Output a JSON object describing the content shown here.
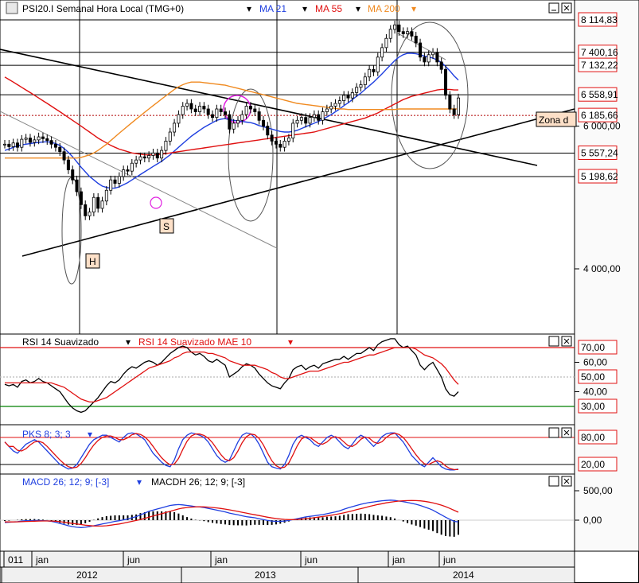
{
  "colors": {
    "price": "#000000",
    "ma21": "#1f3fe0",
    "ma55": "#e01010",
    "ma200": "#f08a20",
    "magenta": "#e020e0",
    "green": "#008000",
    "axis_bg": "#f4f4f4"
  },
  "header": {
    "title": "PSI20.I Semanal Hora Local (TMG+0)",
    "ma21": "MA 21",
    "ma55": "MA 55",
    "ma200": "MA 200"
  },
  "annotations": {
    "h": "H",
    "s": "S",
    "zona": "Zona d"
  },
  "price_labels": [
    {
      "text": "8 114,83",
      "value": 8114.83,
      "color": "#e01010"
    },
    {
      "text": "7 400,16",
      "value": 7400.16,
      "color": "#e01010"
    },
    {
      "text": "7 132,22",
      "value": 7132.22,
      "color": "#e01010"
    },
    {
      "text": "6 558,91",
      "value": 6558.91,
      "color": "#e01010"
    },
    {
      "text": "6 185,66",
      "value": 6185.66,
      "color": "#e01010"
    },
    {
      "text": "5 557,24",
      "value": 5557.24,
      "color": "#e01010"
    },
    {
      "text": "5 198,62",
      "value": 5198.62,
      "color": "#e01010"
    }
  ],
  "price_ticks": [
    {
      "text": "6 000,00",
      "value": 6000
    },
    {
      "text": "4 000,00",
      "value": 4000
    }
  ],
  "rsi": {
    "label": "RSI 14 Suavizado",
    "label2": "RSI 14 Suavizado MAE 10",
    "badges": [
      {
        "text": "70,00",
        "value": 70
      },
      {
        "text": "50,00",
        "value": 50
      },
      {
        "text": "30,00",
        "value": 30
      }
    ],
    "ticks": [
      {
        "text": "60,00",
        "value": 60
      },
      {
        "text": "40,00",
        "value": 40
      }
    ]
  },
  "pks": {
    "label": "PKS 8; 3; 3",
    "badges": [
      {
        "text": "80,00",
        "value": 80
      },
      {
        "text": "20,00",
        "value": 20
      }
    ]
  },
  "macd": {
    "label": "MACD 26; 12; 9; [-3]",
    "label2": "MACDH 26; 12; 9; [-3]",
    "ticks": [
      {
        "text": "500,00",
        "value": 500
      },
      {
        "text": "0,00",
        "value": 0
      }
    ]
  },
  "time_axis": {
    "months": [
      "011",
      "jan",
      "jun",
      "jan",
      "jun",
      "jan",
      "jun"
    ],
    "years": [
      "2012",
      "2013",
      "2014"
    ]
  },
  "chart_data": {
    "type": "line",
    "instrument": "PSI20.I",
    "timeframe": "Semanal",
    "y_range": [
      3300,
      8200
    ],
    "close": [
      5700,
      5660,
      5720,
      5650,
      5780,
      5800,
      5730,
      5770,
      5820,
      5790,
      5760,
      5700,
      5650,
      5580,
      5450,
      5300,
      5150,
      4980,
      4800,
      4650,
      4700,
      4900,
      4750,
      4850,
      5000,
      5150,
      5100,
      5200,
      5300,
      5280,
      5400,
      5450,
      5500,
      5480,
      5520,
      5560,
      5480,
      5600,
      5750,
      5900,
      6050,
      6200,
      6350,
      6400,
      6300,
      6250,
      6350,
      6300,
      6200,
      6150,
      6300,
      6250,
      6200,
      5950,
      6050,
      6100,
      6200,
      6350,
      6300,
      6250,
      6100,
      6000,
      5850,
      5750,
      5700,
      5650,
      5750,
      5800,
      6050,
      6100,
      6150,
      6050,
      6150,
      6200,
      6100,
      6250,
      6300,
      6350,
      6400,
      6450,
      6550,
      6500,
      6600,
      6700,
      6750,
      6900,
      7050,
      7000,
      7300,
      7500,
      7700,
      7900,
      8000,
      7850,
      7800,
      7850,
      7750,
      7600,
      7300,
      7200,
      7350,
      7400,
      7200,
      7050,
      6550,
      6300,
      6200,
      6500
    ],
    "series": [
      {
        "name": "MA 21",
        "values": [
          5600,
          5620,
          5650,
          5670,
          5690,
          5700,
          5710,
          5720,
          5730,
          5735,
          5740,
          5730,
          5710,
          5680,
          5630,
          5570,
          5500,
          5420,
          5340,
          5270,
          5200,
          5150,
          5100,
          5060,
          5040,
          5030,
          5030,
          5050,
          5080,
          5110,
          5150,
          5190,
          5230,
          5270,
          5310,
          5350,
          5390,
          5430,
          5480,
          5530,
          5590,
          5650,
          5710,
          5770,
          5830,
          5880,
          5930,
          5980,
          6020,
          6060,
          6100,
          6120,
          6130,
          6110,
          6100,
          6090,
          6080,
          6070,
          6060,
          6040,
          6010,
          5990,
          5970,
          5950,
          5930,
          5910,
          5900,
          5900,
          5910,
          5930,
          5960,
          5990,
          6020,
          6050,
          6080,
          6120,
          6160,
          6200,
          6250,
          6300,
          6360,
          6410,
          6470,
          6530,
          6590,
          6660,
          6730,
          6800,
          6880,
          6960,
          7050,
          7140,
          7230,
          7300,
          7350,
          7380,
          7380,
          7370,
          7350,
          7320,
          7300,
          7280,
          7240,
          7190,
          7110,
          7020,
          6920,
          6840
        ]
      },
      {
        "name": "MA 55",
        "values": [
          6900,
          6850,
          6800,
          6750,
          6700,
          6650,
          6600,
          6550,
          6500,
          6450,
          6400,
          6350,
          6300,
          6250,
          6200,
          6150,
          6100,
          6050,
          6000,
          5950,
          5900,
          5850,
          5800,
          5760,
          5720,
          5680,
          5650,
          5620,
          5600,
          5580,
          5560,
          5550,
          5540,
          5530,
          5530,
          5530,
          5530,
          5540,
          5550,
          5560,
          5570,
          5580,
          5590,
          5600,
          5610,
          5620,
          5630,
          5640,
          5650,
          5660,
          5670,
          5680,
          5690,
          5700,
          5710,
          5720,
          5730,
          5740,
          5750,
          5760,
          5770,
          5780,
          5790,
          5800,
          5810,
          5820,
          5830,
          5840,
          5850,
          5860,
          5870,
          5880,
          5890,
          5900,
          5920,
          5940,
          5960,
          5980,
          6000,
          6020,
          6040,
          6060,
          6080,
          6100,
          6120,
          6140,
          6170,
          6200,
          6230,
          6270,
          6310,
          6350,
          6390,
          6430,
          6470,
          6500,
          6530,
          6550,
          6570,
          6590,
          6610,
          6630,
          6650,
          6660,
          6660,
          6660,
          6650,
          6650
        ]
      },
      {
        "name": "MA 200",
        "values": [
          5480,
          5480,
          5480,
          5480,
          5480,
          5480,
          5480,
          5480,
          5480,
          5480,
          5480,
          5480,
          5480,
          5480,
          5480,
          5480,
          5480,
          5480,
          5490,
          5510,
          5530,
          5560,
          5600,
          5650,
          5700,
          5760,
          5820,
          5880,
          5940,
          6000,
          6060,
          6120,
          6180,
          6240,
          6300,
          6360,
          6420,
          6480,
          6540,
          6600,
          6660,
          6710,
          6750,
          6780,
          6800,
          6800,
          6800,
          6790,
          6780,
          6770,
          6760,
          6750,
          6740,
          6720,
          6700,
          6680,
          6660,
          6640,
          6620,
          6600,
          6580,
          6560,
          6540,
          6520,
          6500,
          6480,
          6460,
          6440,
          6420,
          6400,
          6390,
          6380,
          6370,
          6360,
          6350,
          6340,
          6330,
          6320,
          6310,
          6300,
          6300,
          6290,
          6290,
          6290,
          6290,
          6290,
          6290,
          6290,
          6290,
          6290,
          6290,
          6290,
          6290,
          6300,
          6300,
          6300,
          6300,
          6300,
          6300,
          6300,
          6300,
          6300,
          6300,
          6300,
          6300,
          6300,
          6300,
          6300
        ]
      }
    ],
    "rsi": [
      45,
      44,
      45,
      43,
      47,
      48,
      46,
      47,
      49,
      47,
      46,
      44,
      42,
      40,
      36,
      32,
      29,
      27,
      26,
      27,
      30,
      33,
      36,
      40,
      44,
      47,
      46,
      48,
      52,
      55,
      57,
      56,
      58,
      60,
      61,
      60,
      58,
      60,
      63,
      66,
      68,
      70,
      71,
      70,
      67,
      65,
      66,
      64,
      61,
      60,
      62,
      60,
      58,
      50,
      52,
      54,
      57,
      59,
      58,
      56,
      52,
      49,
      46,
      44,
      43,
      42,
      46,
      49,
      55,
      57,
      58,
      55,
      57,
      58,
      56,
      59,
      60,
      61,
      62,
      62,
      64,
      62,
      64,
      66,
      66,
      68,
      70,
      68,
      72,
      74,
      75,
      76,
      76,
      72,
      70,
      71,
      68,
      65,
      58,
      55,
      58,
      60,
      55,
      50,
      42,
      38,
      37,
      40
    ],
    "rsi_ma": [
      46,
      46,
      46,
      46,
      46,
      46,
      46,
      46,
      46,
      46,
      46,
      46,
      45,
      44,
      43,
      41,
      39,
      37,
      35,
      34,
      33,
      33,
      34,
      35,
      36,
      38,
      40,
      42,
      44,
      46,
      48,
      50,
      52,
      54,
      56,
      57,
      58,
      59,
      60,
      61,
      63,
      64,
      66,
      67,
      67,
      67,
      67,
      67,
      66,
      66,
      65,
      64,
      63,
      61,
      60,
      59,
      58,
      58,
      58,
      58,
      57,
      56,
      55,
      53,
      52,
      50,
      49,
      49,
      50,
      51,
      52,
      53,
      54,
      54,
      54,
      55,
      56,
      57,
      58,
      59,
      60,
      60,
      61,
      62,
      63,
      64,
      65,
      65,
      66,
      67,
      68,
      69,
      70,
      70,
      70,
      70,
      70,
      69,
      67,
      65,
      64,
      63,
      61,
      59,
      56,
      52,
      48,
      45
    ],
    "pks": [
      70,
      60,
      50,
      45,
      55,
      65,
      70,
      75,
      70,
      60,
      50,
      40,
      30,
      20,
      15,
      10,
      12,
      20,
      35,
      50,
      65,
      75,
      80,
      85,
      85,
      80,
      75,
      70,
      80,
      88,
      90,
      88,
      82,
      75,
      60,
      45,
      35,
      25,
      18,
      15,
      30,
      55,
      75,
      85,
      90,
      88,
      85,
      80,
      70,
      55,
      40,
      30,
      25,
      30,
      50,
      70,
      85,
      90,
      88,
      80,
      65,
      45,
      25,
      15,
      12,
      10,
      20,
      40,
      65,
      80,
      85,
      80,
      75,
      65,
      60,
      70,
      80,
      85,
      80,
      70,
      60,
      55,
      65,
      78,
      85,
      80,
      70,
      60,
      70,
      82,
      88,
      90,
      90,
      80,
      70,
      55,
      40,
      30,
      20,
      15,
      25,
      35,
      25,
      15,
      10,
      8,
      8,
      10
    ],
    "macd": [
      -40,
      -35,
      -30,
      -25,
      -15,
      -10,
      -8,
      -5,
      -5,
      -8,
      -12,
      -20,
      -35,
      -55,
      -75,
      -95,
      -110,
      -120,
      -125,
      -120,
      -110,
      -95,
      -80,
      -65,
      -50,
      -35,
      -20,
      -10,
      5,
      20,
      40,
      60,
      90,
      120,
      150,
      170,
      190,
      210,
      230,
      250,
      260,
      265,
      260,
      250,
      240,
      230,
      225,
      215,
      200,
      185,
      170,
      155,
      140,
      120,
      105,
      90,
      75,
      60,
      50,
      40,
      25,
      10,
      -5,
      -15,
      -20,
      -20,
      -15,
      -5,
      10,
      25,
      40,
      55,
      65,
      75,
      85,
      95,
      110,
      125,
      140,
      160,
      185,
      210,
      230,
      250,
      270,
      285,
      300,
      310,
      320,
      330,
      335,
      340,
      335,
      325,
      315,
      300,
      285,
      270,
      250,
      225,
      200,
      170,
      130,
      90,
      50,
      15,
      -20,
      -30
    ],
    "macd_signal": [
      -30,
      -30,
      -30,
      -28,
      -25,
      -22,
      -20,
      -18,
      -15,
      -14,
      -13,
      -15,
      -18,
      -25,
      -35,
      -45,
      -55,
      -65,
      -75,
      -85,
      -92,
      -98,
      -100,
      -100,
      -95,
      -85,
      -75,
      -65,
      -50,
      -35,
      -20,
      -5,
      10,
      30,
      50,
      70,
      90,
      110,
      130,
      150,
      170,
      190,
      205,
      215,
      222,
      226,
      228,
      226,
      222,
      215,
      208,
      198,
      188,
      175,
      162,
      148,
      134,
      120,
      106,
      92,
      78,
      64,
      50,
      38,
      28,
      20,
      14,
      10,
      10,
      12,
      18,
      25,
      33,
      42,
      52,
      62,
      72,
      84,
      96,
      110,
      125,
      142,
      160,
      178,
      196,
      214,
      232,
      250,
      266,
      280,
      294,
      306,
      316,
      324,
      330,
      333,
      334,
      332,
      328,
      320,
      308,
      294,
      276,
      255,
      230,
      200,
      168,
      135
    ]
  }
}
